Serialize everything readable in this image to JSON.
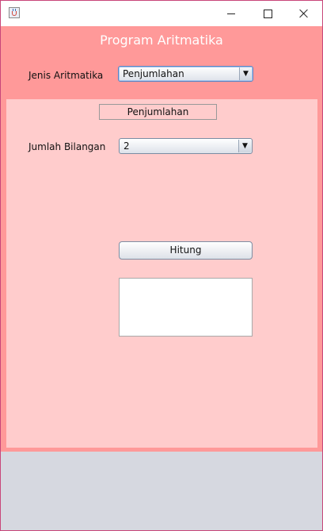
{
  "window": {
    "title": "",
    "controls": {
      "minimize": "minimize",
      "maximize": "maximize",
      "close": "close"
    }
  },
  "header": {
    "title": "Program Aritmatika"
  },
  "jenis": {
    "label": "Jenis Aritmatika",
    "selected": "Penjumlahan"
  },
  "panel": {
    "heading": "Penjumlahan",
    "jumlah_label": "Jumlah Bilangan",
    "jumlah_selected": "2",
    "button_label": "Hitung",
    "result": ""
  },
  "colors": {
    "main_bg": "#ff9999",
    "inner_bg": "#ffcccc",
    "footer_bg": "#d6d8e0",
    "title_text": "#ffffff"
  },
  "icons": [
    "java-app-icon",
    "minimize-icon",
    "maximize-icon",
    "close-icon",
    "dropdown-arrow-icon"
  ]
}
